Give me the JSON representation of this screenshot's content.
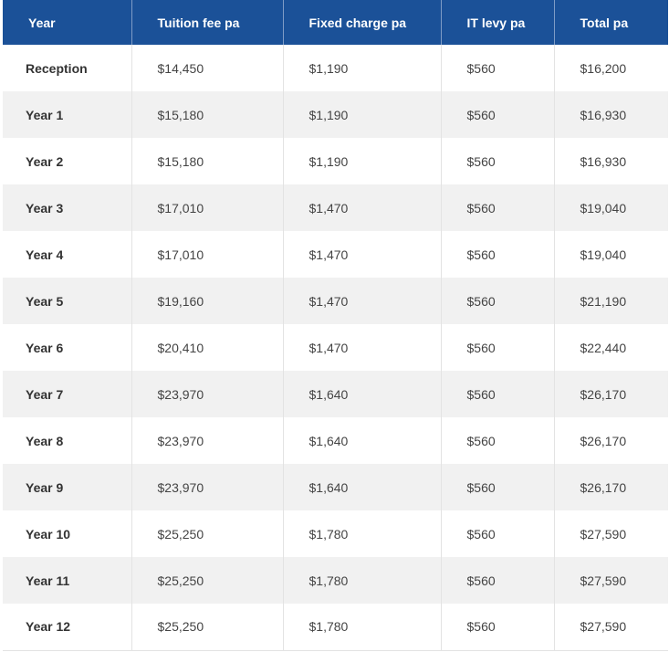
{
  "table": {
    "headers": [
      "Year",
      "Tuition fee pa",
      "Fixed charge pa",
      "IT levy pa",
      "Total pa"
    ],
    "rows": [
      [
        "Reception",
        "$14,450",
        "$1,190",
        "$560",
        "$16,200"
      ],
      [
        "Year 1",
        "$15,180",
        "$1,190",
        "$560",
        "$16,930"
      ],
      [
        "Year 2",
        "$15,180",
        "$1,190",
        "$560",
        "$16,930"
      ],
      [
        "Year 3",
        "$17,010",
        "$1,470",
        "$560",
        "$19,040"
      ],
      [
        "Year 4",
        "$17,010",
        "$1,470",
        "$560",
        "$19,040"
      ],
      [
        "Year 5",
        "$19,160",
        "$1,470",
        "$560",
        "$21,190"
      ],
      [
        "Year 6",
        "$20,410",
        "$1,470",
        "$560",
        "$22,440"
      ],
      [
        "Year 7",
        "$23,970",
        "$1,640",
        "$560",
        "$26,170"
      ],
      [
        "Year 8",
        "$23,970",
        "$1,640",
        "$560",
        "$26,170"
      ],
      [
        "Year 9",
        "$23,970",
        "$1,640",
        "$560",
        "$26,170"
      ],
      [
        "Year 10",
        "$25,250",
        "$1,780",
        "$560",
        "$27,590"
      ],
      [
        "Year 11",
        "$25,250",
        "$1,780",
        "$560",
        "$27,590"
      ],
      [
        "Year 12",
        "$25,250",
        "$1,780",
        "$560",
        "$27,590"
      ]
    ]
  },
  "colors": {
    "header_background": "#1b5198",
    "header_text": "#ffffff",
    "row_alt_background": "#f1f1f1",
    "row_background": "#ffffff"
  }
}
